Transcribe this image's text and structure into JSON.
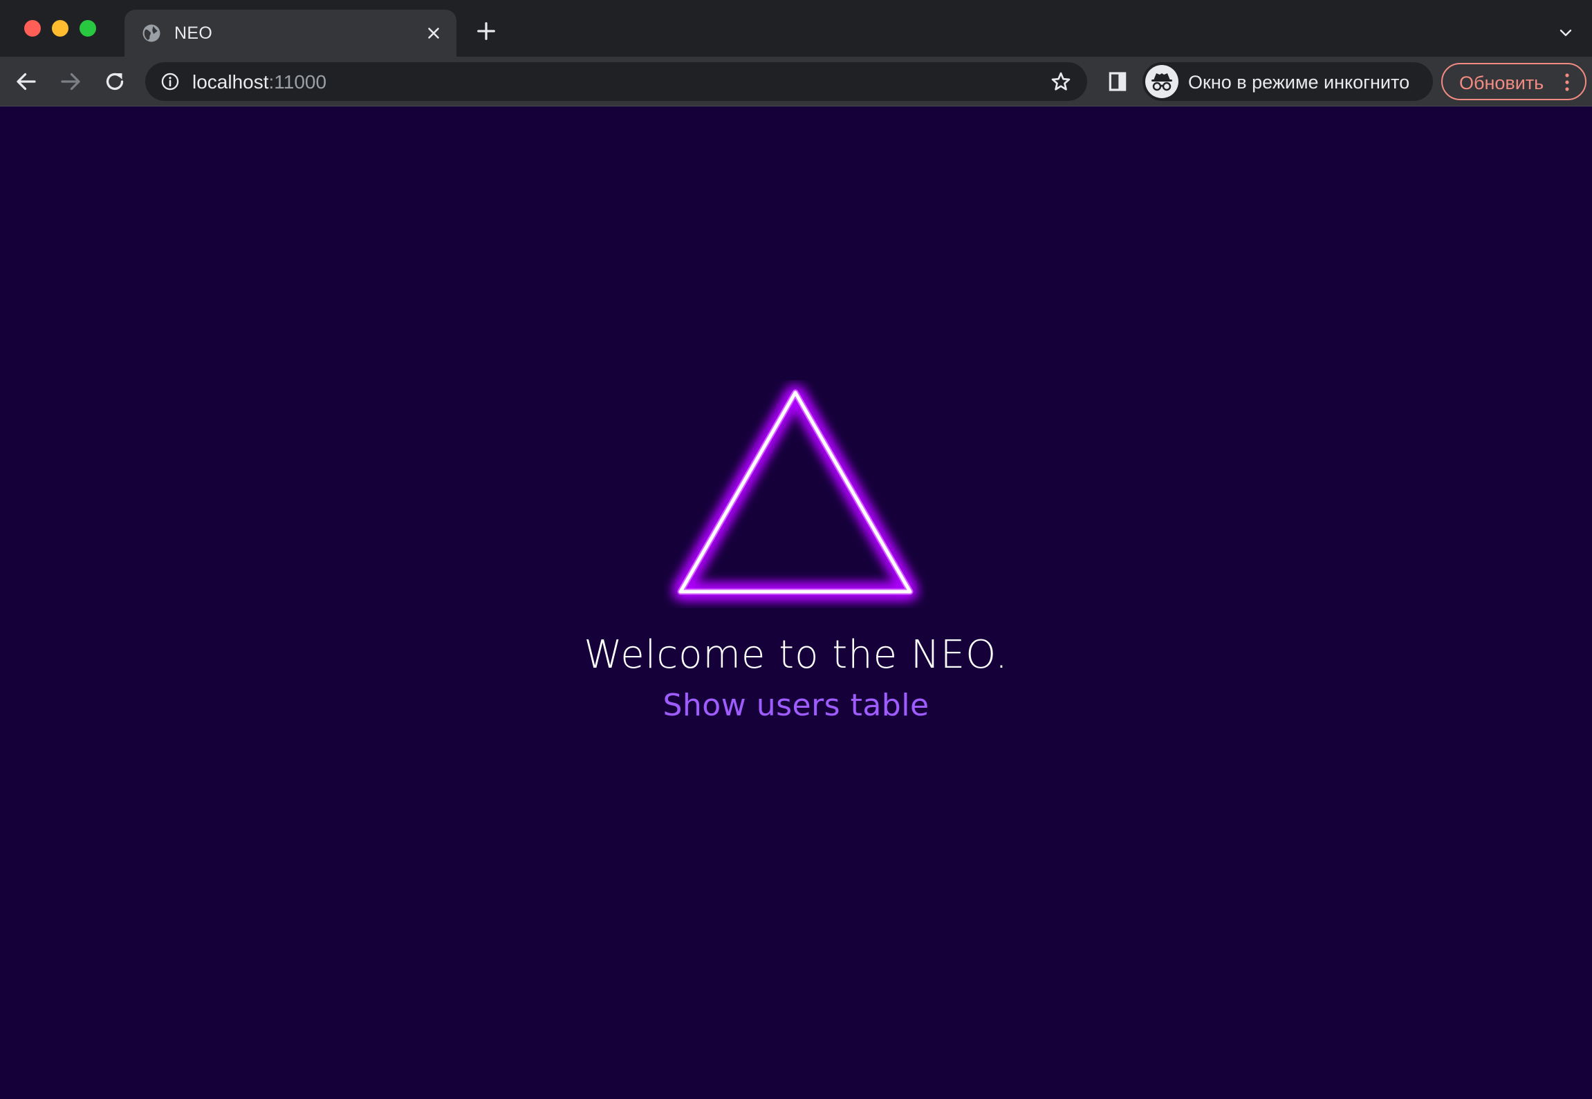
{
  "browser": {
    "tab": {
      "title": "NEO",
      "favicon": "globe-icon"
    },
    "address_bar": {
      "host": "localhost",
      "port": ":11000"
    },
    "incognito": {
      "label": "Окно в режиме инкогнито"
    },
    "update_button": {
      "label": "Обновить"
    },
    "colors": {
      "chrome_dark": "#202124",
      "chrome_mid": "#35363a",
      "update_accent": "#f28b82"
    }
  },
  "page": {
    "background": "#16003a",
    "logo": {
      "shape": "neon-triangle",
      "glow_color": "#b000ff"
    },
    "welcome_text": "Welcome to the NEO.",
    "link_text": "Show users table",
    "link_color": "#9f5cff"
  }
}
